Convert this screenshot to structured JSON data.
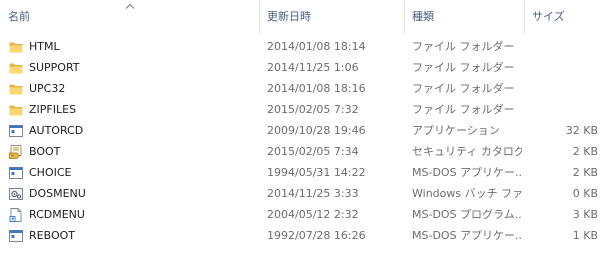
{
  "columns": {
    "name": "名前",
    "date": "更新日時",
    "type": "種類",
    "size": "サイズ"
  },
  "files": [
    {
      "name": "HTML",
      "date": "2014/01/08 18:14",
      "type": "ファイル フォルダー",
      "size": "",
      "icon": "folder-icon"
    },
    {
      "name": "SUPPORT",
      "date": "2014/11/25 1:06",
      "type": "ファイル フォルダー",
      "size": "",
      "icon": "folder-icon"
    },
    {
      "name": "UPC32",
      "date": "2014/01/08 18:16",
      "type": "ファイル フォルダー",
      "size": "",
      "icon": "folder-icon"
    },
    {
      "name": "ZIPFILES",
      "date": "2015/02/05 7:32",
      "type": "ファイル フォルダー",
      "size": "",
      "icon": "folder-icon"
    },
    {
      "name": "AUTORCD",
      "date": "2009/10/28 19:46",
      "type": "アプリケーション",
      "size": "32 KB",
      "icon": "application-icon"
    },
    {
      "name": "BOOT",
      "date": "2015/02/05 7:34",
      "type": "セキュリティ カタログ",
      "size": "2 KB",
      "icon": "security-catalog-icon"
    },
    {
      "name": "CHOICE",
      "date": "1994/05/31 14:22",
      "type": "MS-DOS アプリケー...",
      "size": "2 KB",
      "icon": "application-icon"
    },
    {
      "name": "DOSMENU",
      "date": "2014/11/25 3:33",
      "type": "Windows バッチ ファ...",
      "size": "0 KB",
      "icon": "batch-file-icon"
    },
    {
      "name": "RCDMENU",
      "date": "2004/05/12 2:32",
      "type": "MS-DOS プログラム...",
      "size": "3 KB",
      "icon": "shortcut-file-icon"
    },
    {
      "name": "REBOOT",
      "date": "1992/07/28 16:26",
      "type": "MS-DOS アプリケー...",
      "size": "1 KB",
      "icon": "application-icon"
    }
  ]
}
